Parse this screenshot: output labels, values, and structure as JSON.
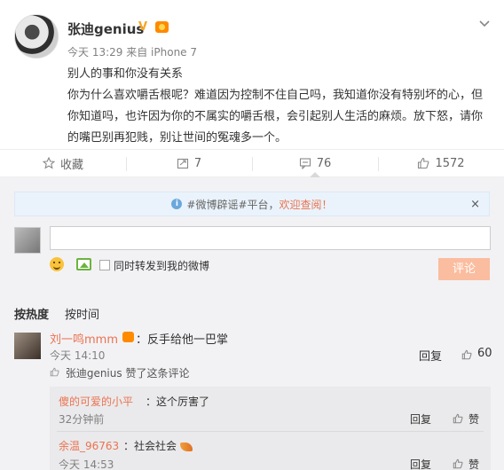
{
  "post": {
    "username": "张迪genius",
    "v_badge": "V",
    "time": "今天 13:29",
    "source": "来自 iPhone 7",
    "content": [
      "别人的事和你没有关系",
      "你为什么喜欢嚼舌根呢？难道因为控制不住自己吗，我知道你没有特别坏的心，但你知道吗，也许因为你的不属实的嚼舌根，会引起别人生活的麻烦。放下怒，请你的嘴巴别再犯贱，别让世间的冤魂多一个。"
    ]
  },
  "actions": {
    "favorite": "收藏",
    "repost": "7",
    "comment": "76",
    "like": "1572"
  },
  "notice": {
    "prefix": "#微博辟谣#平台，",
    "highlight": "欢迎查阅！",
    "close": "×"
  },
  "composer": {
    "input_value": "",
    "repost_label": "同时转发到我的微博",
    "submit": "评论"
  },
  "sort": {
    "hot": "按热度",
    "time": "按时间"
  },
  "comment1": {
    "name": "刘一鸣mmm",
    "text": "：反手给他一巴掌",
    "time": "今天 14:10",
    "reply": "回复",
    "likes": "60",
    "liked_by": "张迪genius 赞了这条评论"
  },
  "replies": [
    {
      "name": "傻的可爱的小平",
      "text": "：这个厉害了",
      "time": "32分钟前",
      "reply": "回复",
      "like": "赞"
    },
    {
      "name": "余温_96763",
      "text": "：社会社会",
      "time": "今天 14:53",
      "reply": "回复",
      "like": "赞"
    }
  ]
}
